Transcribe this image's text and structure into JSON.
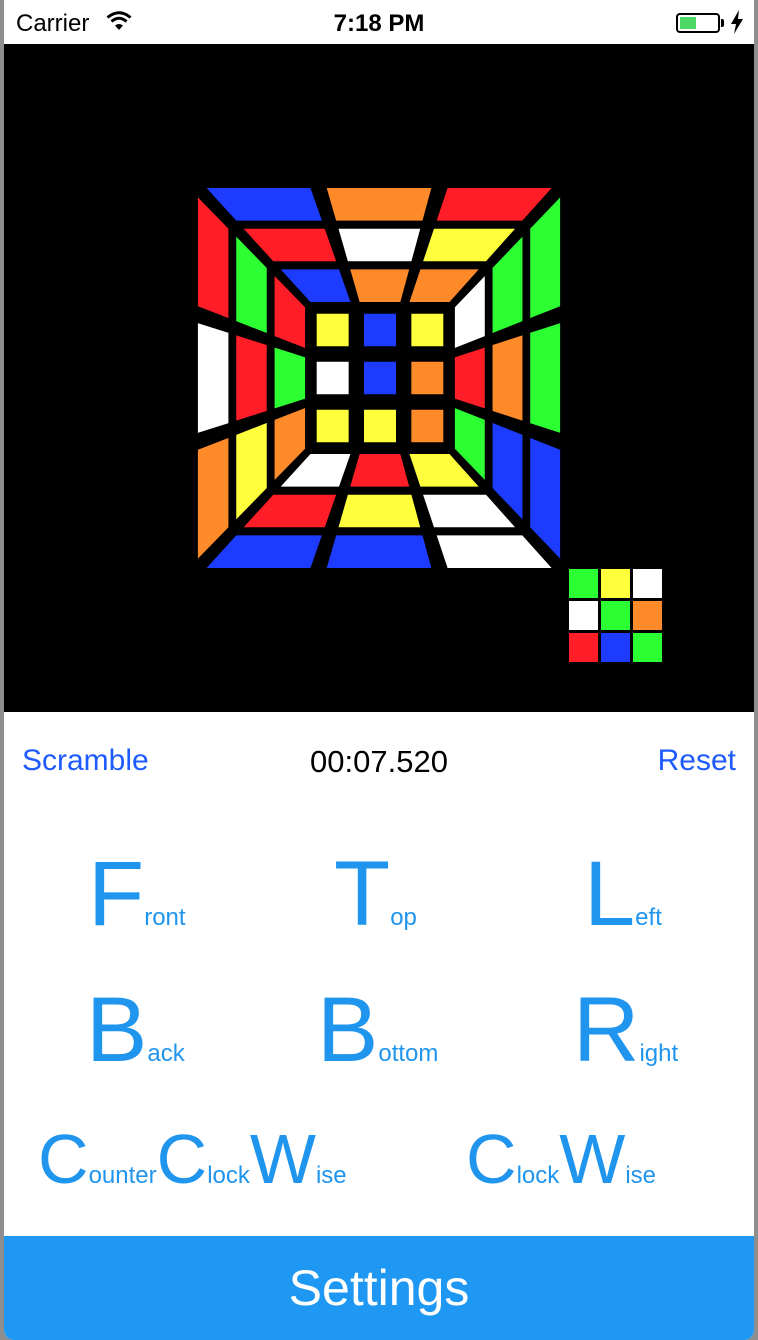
{
  "status_bar": {
    "carrier": "Carrier",
    "time": "7:18 PM",
    "battery_level": 0.45
  },
  "colors": {
    "red": "#ff1e28",
    "blue": "#1e3cff",
    "orange": "#ff8a2a",
    "yellow": "#ffff3c",
    "white": "#ffffff",
    "green": "#2cff32",
    "accent": "#1e98f2",
    "link": "#1e5bff"
  },
  "controls": {
    "scramble_label": "Scramble",
    "timer": "00:07.520",
    "reset_label": "Reset"
  },
  "moves": {
    "front": {
      "big": "F",
      "small": "ront"
    },
    "top": {
      "big": "T",
      "small": "op"
    },
    "left": {
      "big": "L",
      "small": "eft"
    },
    "back": {
      "big": "B",
      "small": "ack"
    },
    "bottom": {
      "big": "B",
      "small": "ottom"
    },
    "right": {
      "big": "R",
      "small": "ight"
    },
    "ccw": {
      "c1": "C",
      "s1": "ounter",
      "c2": "C",
      "s2": "lock",
      "c3": "W",
      "s3": "ise"
    },
    "cw": {
      "c1": "C",
      "s1": "lock",
      "c2": "W",
      "s2": "ise"
    }
  },
  "settings_label": "Settings",
  "cube": {
    "top_face": [
      [
        "blue",
        "orange",
        "red"
      ],
      [
        "red",
        "white",
        "yellow"
      ],
      [
        "blue",
        "orange",
        "orange"
      ]
    ],
    "left_face": [
      [
        "red",
        "green",
        "red"
      ],
      [
        "white",
        "red",
        "green"
      ],
      [
        "orange",
        "yellow",
        "orange"
      ]
    ],
    "right_face": [
      [
        "white",
        "green",
        "green"
      ],
      [
        "red",
        "orange",
        "green"
      ],
      [
        "green",
        "blue",
        "blue"
      ]
    ],
    "bottom_face": [
      [
        "white",
        "red",
        "yellow"
      ],
      [
        "red",
        "yellow",
        "white"
      ],
      [
        "blue",
        "blue",
        "white"
      ]
    ],
    "back_face": [
      [
        "yellow",
        "blue",
        "yellow"
      ],
      [
        "white",
        "blue",
        "orange"
      ],
      [
        "yellow",
        "yellow",
        "orange"
      ]
    ],
    "front_preview": [
      [
        "green",
        "yellow",
        "white"
      ],
      [
        "white",
        "green",
        "orange"
      ],
      [
        "red",
        "blue",
        "green"
      ]
    ]
  }
}
